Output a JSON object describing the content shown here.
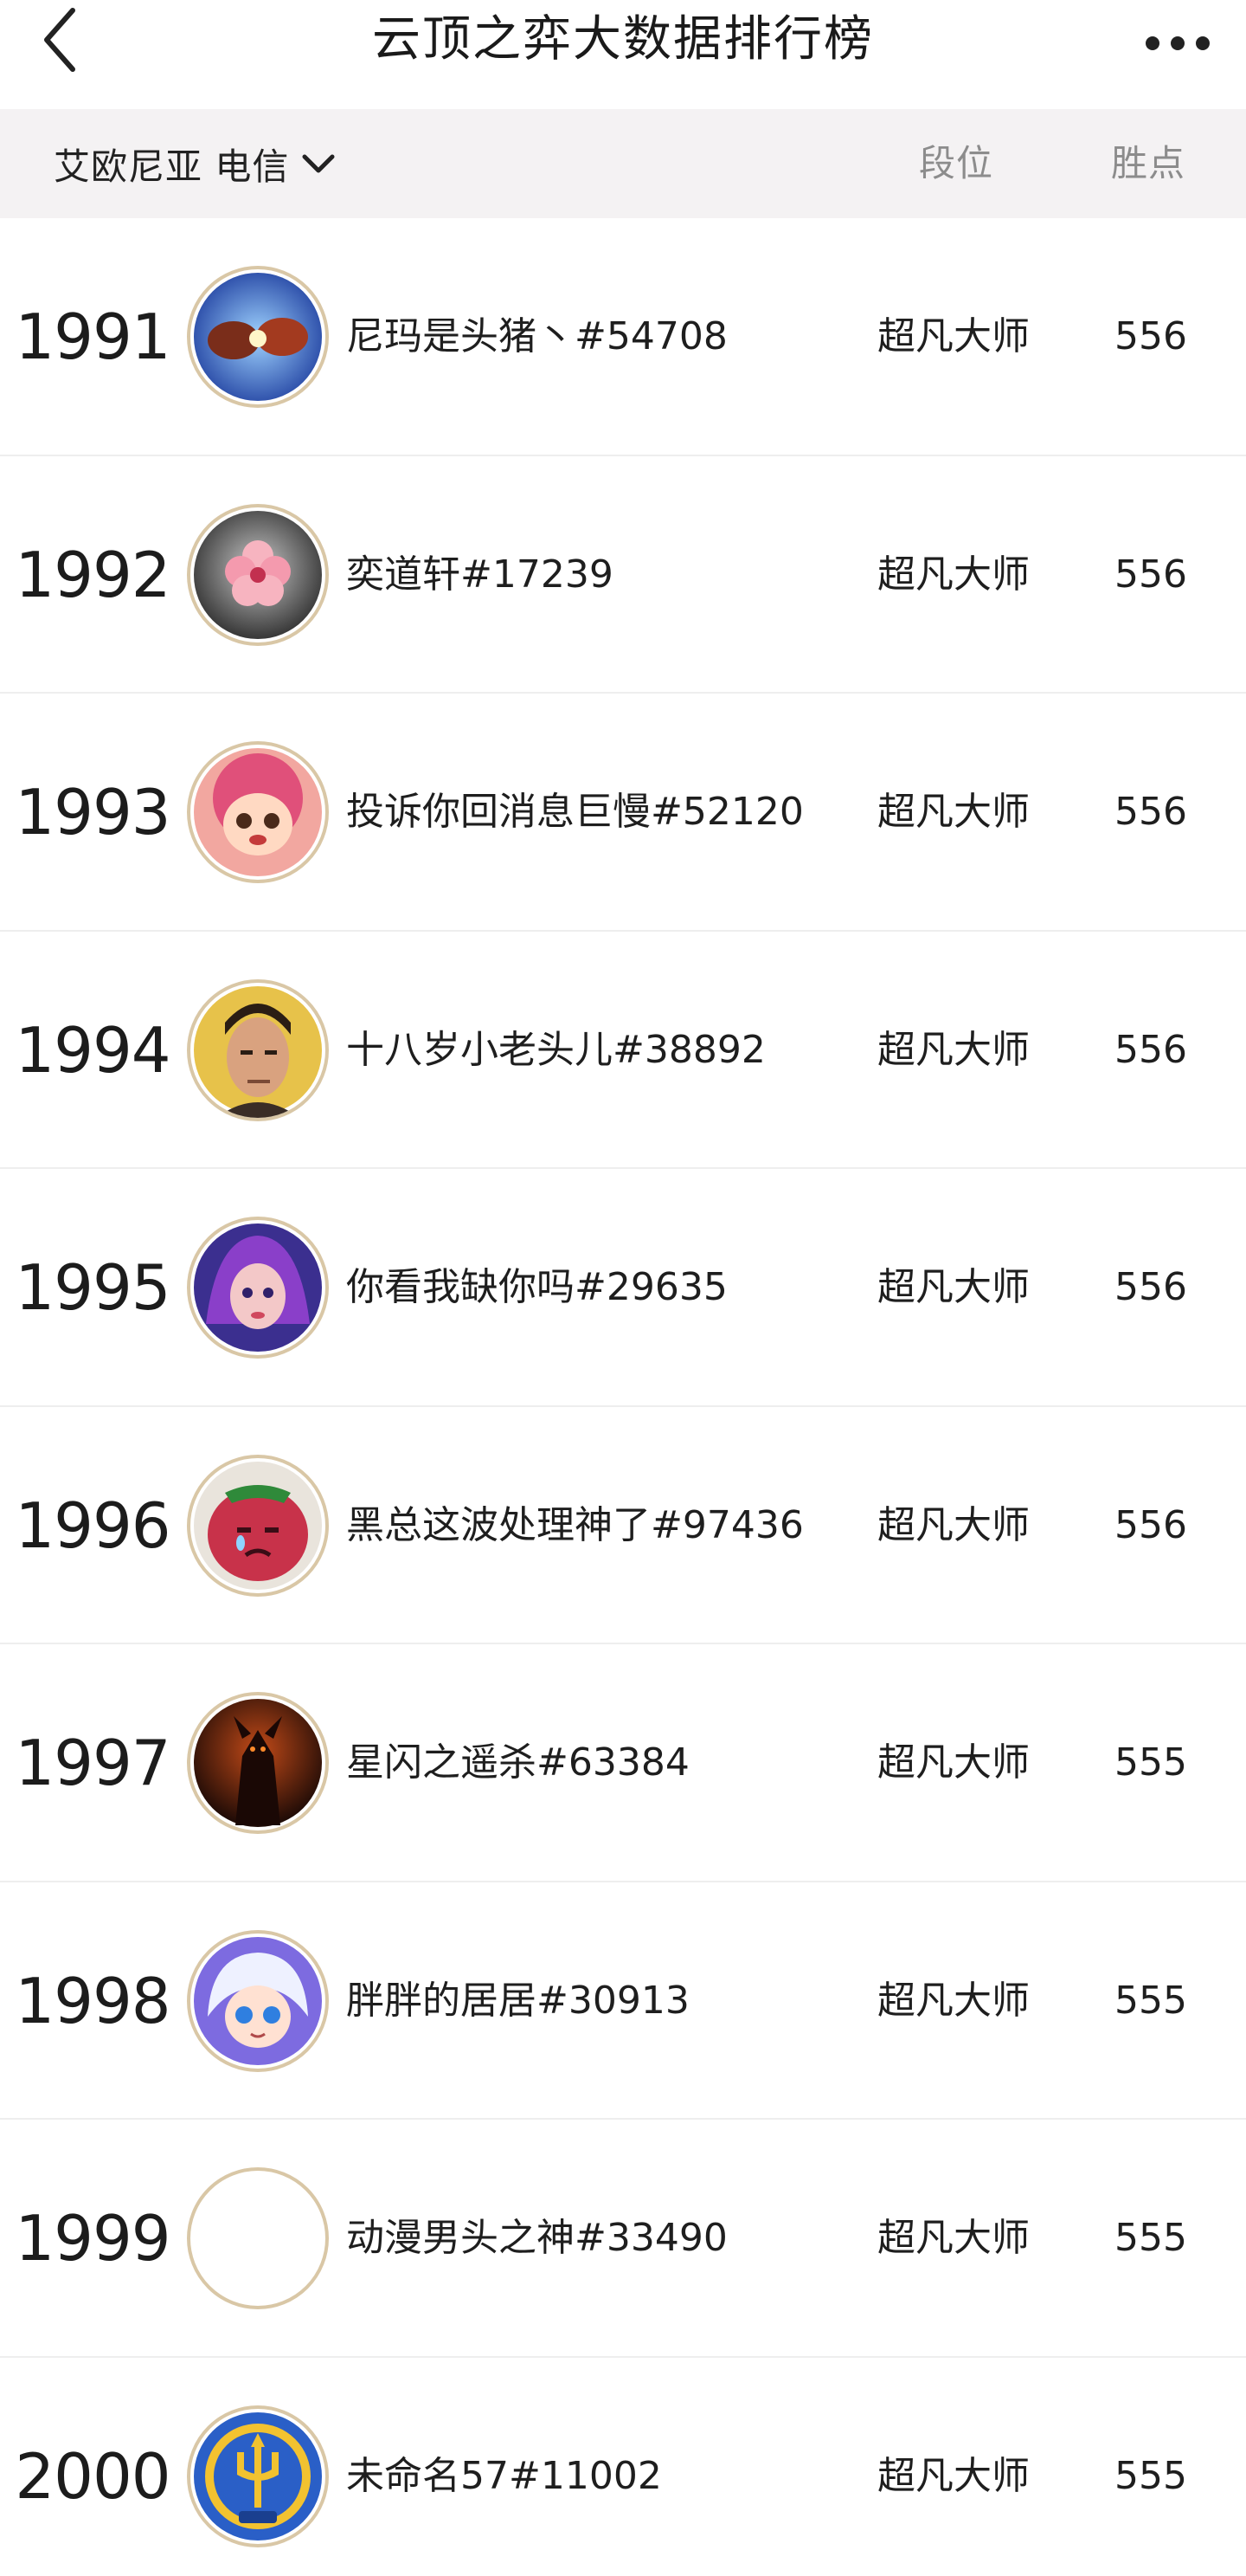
{
  "header": {
    "title": "云顶之弈大数据排行榜"
  },
  "icons": {
    "back": "chevron-left-icon",
    "more": "more-dots-icon",
    "dropdown": "chevron-down-icon"
  },
  "filter": {
    "server": "艾欧尼亚 电信"
  },
  "columns": {
    "rank": "段位",
    "points": "胜点"
  },
  "rows": [
    {
      "rank": "1991",
      "name": "尼玛是头猪丶#54708",
      "tier": "超凡大师",
      "points": "556",
      "avatar": "fist-bump-avatar"
    },
    {
      "rank": "1992",
      "name": "奕道轩#17239",
      "tier": "超凡大师",
      "points": "556",
      "avatar": "flower-avatar"
    },
    {
      "rank": "1993",
      "name": "投诉你回消息巨慢#52120",
      "tier": "超凡大师",
      "points": "556",
      "avatar": "pink-hair-girl-avatar"
    },
    {
      "rank": "1994",
      "name": "十八岁小老头儿#38892",
      "tier": "超凡大师",
      "points": "556",
      "avatar": "man-portrait-avatar"
    },
    {
      "rank": "1995",
      "name": "你看我缺你吗#29635",
      "tier": "超凡大师",
      "points": "556",
      "avatar": "purple-hair-girl-avatar"
    },
    {
      "rank": "1996",
      "name": "黑总这波处理神了#97436",
      "tier": "超凡大师",
      "points": "556",
      "avatar": "crying-tomato-avatar"
    },
    {
      "rank": "1997",
      "name": "星闪之遥杀#63384",
      "tier": "超凡大师",
      "points": "555",
      "avatar": "dark-warrior-avatar"
    },
    {
      "rank": "1998",
      "name": "胖胖的居居#30913",
      "tier": "超凡大师",
      "points": "555",
      "avatar": "white-hair-chibi-avatar"
    },
    {
      "rank": "1999",
      "name": "动漫男头之神#33490",
      "tier": "超凡大师",
      "points": "555",
      "avatar": "empty-avatar"
    },
    {
      "rank": "2000",
      "name": "未命名57#11002",
      "tier": "超凡大师",
      "points": "555",
      "avatar": "trident-emblem-avatar"
    }
  ],
  "colors": {
    "filter_bg": "#f4f2f3",
    "avatar_ring": "#d9c7a6",
    "header_muted": "#8c8c8c"
  }
}
